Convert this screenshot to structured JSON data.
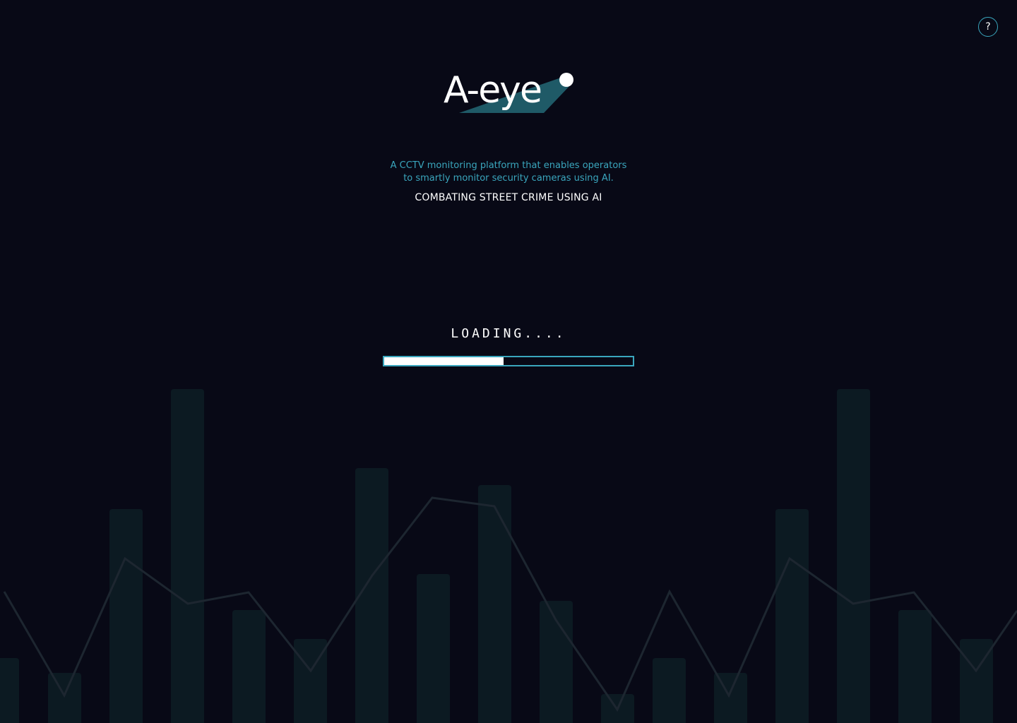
{
  "app": {
    "logo_text": "A-eye",
    "tagline_line1": "A CCTV monitoring platform that enables operators",
    "tagline_line2": "to smartly monitor security cameras using AI.",
    "subtitle": "COMBATING STREET CRIME USING AI"
  },
  "help": {
    "label": "?",
    "icon": "question-icon"
  },
  "loading": {
    "text": "LOADING....",
    "progress": 0.48
  },
  "colors": {
    "background": "#080916",
    "accent": "#3aa6bd",
    "logo_teal": "#1f5a67",
    "bars": "#0c1a22",
    "line": "#1d2630",
    "text": "#ffffff"
  }
}
